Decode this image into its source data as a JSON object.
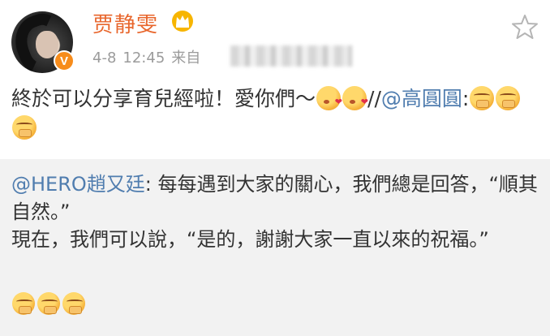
{
  "post": {
    "username": "贾静雯",
    "verified_badge": "V",
    "date": "4-8",
    "time": "12:45",
    "source_prefix": "来自",
    "content_text": "終於可以分享育兒經啦！愛你們～",
    "content_separator": "//",
    "mention": "@高圓圓",
    "mention_suffix": ":",
    "content_emojis": [
      "kiss-emoji",
      "kiss-emoji"
    ],
    "trailing_emojis": [
      "shy-emoji",
      "shy-emoji",
      "shy-emoji"
    ],
    "icons": [
      "crown-icon",
      "star-icon",
      "verified-badge-icon"
    ]
  },
  "repost": {
    "author": "@HERO趙又廷",
    "colon": ":",
    "line1": " 每每遇到大家的關心，我們總是回答，“順其自然。”",
    "line2": "現在，我們可以說，“是的，謝謝大家一直以來的祝福。”",
    "emojis": [
      "shy-emoji",
      "shy-emoji",
      "shy-emoji"
    ]
  },
  "colors": {
    "username": "#e8662c",
    "mention": "#507daf",
    "meta": "#9b9b9b",
    "repost_bg": "#f2f2f2"
  }
}
